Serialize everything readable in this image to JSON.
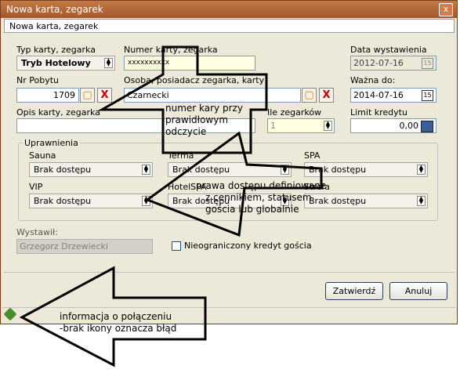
{
  "window": {
    "title": "Nowa karta, zegarek",
    "close_glyph": "x"
  },
  "subheader": "Nowa karta, zegarek",
  "labels": {
    "typ": "Typ karty, zegarka",
    "numer": "Numer karty, zegarka",
    "data": "Data wystawienia",
    "nr_pobytu": "Nr Pobytu",
    "osoba": "Osoba, posiadacz zegarka, karty",
    "wazna": "Ważna do:",
    "opis": "Opis karty, zegarka",
    "ile": "Ile zegarków",
    "limit": "Limit kredytu",
    "uprawnienia": "Uprawnienia",
    "sauna": "Sauna",
    "terma": "Terma",
    "spa": "SPA",
    "vip": "VIP",
    "hotelspa": "HotelSPA",
    "strefa": "Strefa",
    "wystawil": "Wystawił:",
    "nieogr": "Nieograniczony kredyt gościa"
  },
  "values": {
    "typ": "Tryb Hotelowy",
    "numer": "xxxxxxxxxx",
    "data": "2012-07-16",
    "nr_pobytu": "1709",
    "osoba": "Czarnecki",
    "wazna": "2014-07-16",
    "ile": "1",
    "limit": "0,00",
    "wystawil": "Grzegorz Drzewiecki",
    "sauna": "Brak dostępu",
    "terma": "Brak dostępu",
    "spa": "Brak dostępu",
    "vip": "Brak dostępu",
    "hotelspa": "Brak dostępu",
    "strefa": "Brak dostępu"
  },
  "buttons": {
    "zatwierdz": "Zatwierdź",
    "anuluj": "Anuluj"
  },
  "annotations": {
    "a1": [
      "numer kary przy",
      "prawidłowym",
      "odczycie"
    ],
    "a2": [
      "prawa dostępu definiowane",
      "z cennikiem, statusem",
      "gościa lub globalnie"
    ],
    "a3": [
      "informacja o połączeniu",
      "-brak ikony oznacza błąd"
    ]
  },
  "icons": [
    "close-icon",
    "folder-icon",
    "delete-x-icon",
    "calendar-icon",
    "calculator-icon",
    "connection-icon"
  ]
}
